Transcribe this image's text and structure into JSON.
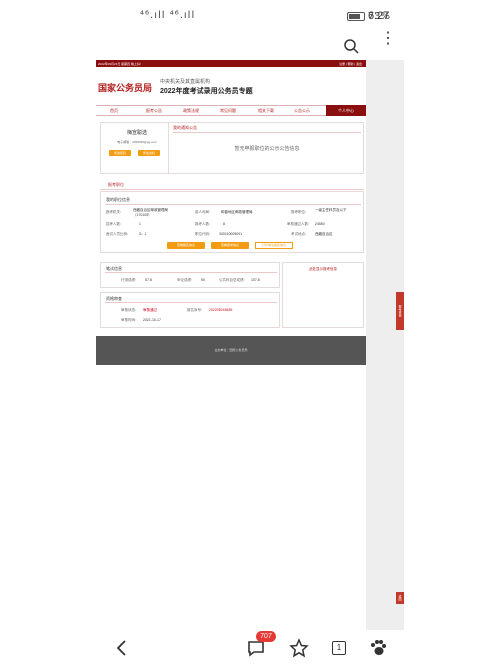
{
  "status_bar": {
    "signal_text": "⁴⁶.ıll ⁴⁶.ıll",
    "battery_percent": "73%",
    "time": "6:27"
  },
  "browser": {
    "search_icon": "search-icon",
    "more_icon": "more-vertical-icon"
  },
  "site": {
    "top_strip_left": "2022年09月24日 星期四 晚上好!",
    "top_strip_right": "注册 | 帮助 | 退出",
    "logo": "国家公务员局",
    "subtitle": "中央机关及其直属机构",
    "title": "2022年度考试录用公务员专题",
    "nav": [
      "首页",
      "报考公告",
      "政策法规",
      "常见问题",
      "相关下载",
      "公告公示"
    ],
    "nav_active": "个人中心"
  },
  "user_panel": {
    "name": "梅宣聪选",
    "email": "电子邮箱：2459430@gg.com",
    "btn_edit": "修改密码",
    "btn_info": "修改资料"
  },
  "notice_panel": {
    "title": "我的通知公告",
    "empty_text": "暂无申报职位的公示公告信息"
  },
  "apply": {
    "section_title": "报考职位",
    "info_title": "我的职位信息",
    "rows": [
      [
        {
          "label": "报考机关：",
          "value": "西藏自治区邮政管理局（170105）"
        },
        {
          "label": "用人司局：",
          "value": "和普地区邮政管理局"
        },
        {
          "label": "报考职位：",
          "value": "一级主任科员及以下"
        }
      ],
      [
        {
          "label": "招考人数：",
          "value": "1"
        },
        {
          "label": "报考人数：",
          "value": "8"
        },
        {
          "label": "审核通过人数：",
          "value": "24560"
        }
      ],
      [
        {
          "label": "面试人员比例：",
          "value": "3：1"
        },
        {
          "label": "职位代码：",
          "value": "300110005001"
        },
        {
          "label": "考试地点：",
          "value": "西藏自治区"
        }
      ]
    ],
    "btn_1": "查看报名信息",
    "btn_2": "查看报考信息",
    "btn_3": "打印考生报名信息"
  },
  "exam": {
    "title": "笔试信息",
    "score_labels": [
      "行测成绩：",
      "申论成绩：",
      "公共科目总成绩："
    ],
    "score_values": [
      "57.8",
      "50",
      "107.8"
    ],
    "side_text": "此处显示报考信息"
  },
  "review": {
    "title": "资格审查",
    "row1_label": "审核状态：",
    "row1_value": "审核通过",
    "row1_label2": "报名序号：",
    "row1_value2": "202205245489",
    "row2_label": "审核时间：",
    "row2_value": "2021-10-17"
  },
  "footer": {
    "text": "主办单位：国家公务员局"
  },
  "side_tab": "报考咨询",
  "side_tab2": "返回",
  "bottom_nav": {
    "badge": "707",
    "tabs_count": "1"
  }
}
